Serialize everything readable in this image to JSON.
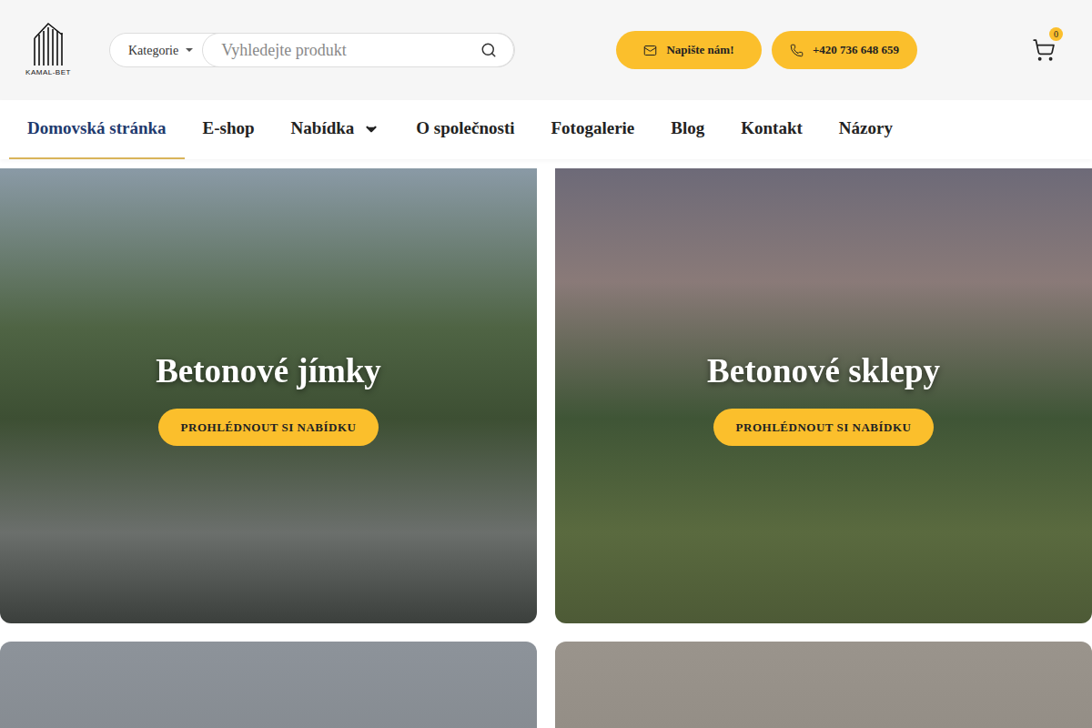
{
  "logo": {
    "text": "KAMAL-BET"
  },
  "search": {
    "category_label": "Kategorie",
    "placeholder": "Vyhledejte produkt"
  },
  "header_buttons": [
    {
      "label": "Napište nám!",
      "kind": "mail"
    },
    {
      "label": "+420 736 648 659",
      "kind": "phone"
    }
  ],
  "cart": {
    "count": "0"
  },
  "nav": [
    {
      "label": "Domovská stránka",
      "selected": true,
      "kind": "link"
    },
    {
      "label": "E-shop",
      "selected": false,
      "kind": "link"
    },
    {
      "label": "Nabídka",
      "selected": false,
      "kind": "dropdown"
    },
    {
      "label": "O společnosti",
      "selected": false,
      "kind": "link"
    },
    {
      "label": "Fotogalerie",
      "selected": false,
      "kind": "link"
    },
    {
      "label": "Blog",
      "selected": false,
      "kind": "link"
    },
    {
      "label": "Kontakt",
      "selected": false,
      "kind": "link"
    },
    {
      "label": "Názory",
      "selected": false,
      "kind": "link"
    }
  ],
  "cards": [
    {
      "kind": "offer",
      "title": "Betonové jímky",
      "button": "PROHLÉDNOUT SI NABÍDKU"
    },
    {
      "kind": "offer",
      "title": "Betonové sklepy",
      "button": "PROHLÉDNOUT SI NABÍDKU"
    },
    {
      "kind": "photo"
    },
    {
      "kind": "photo"
    }
  ]
}
